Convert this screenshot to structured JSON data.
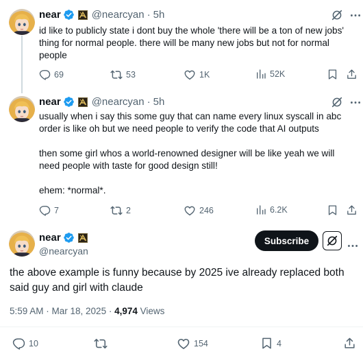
{
  "tweets": [
    {
      "name": "near",
      "handle": "@nearcyan",
      "separator": "·",
      "time": "5h",
      "text": "id like to publicly state i dont buy the whole 'there will be a ton of new jobs'\nthing for normal people. there will be many new jobs but not for normal\npeople",
      "replies": "69",
      "reposts": "53",
      "likes": "1K",
      "views": "52K"
    },
    {
      "name": "near",
      "handle": "@nearcyan",
      "separator": "·",
      "time": "5h",
      "text": "usually when i say this some guy that can name every linux syscall in abc\norder is like oh but we need people to verify the code that AI outputs\n\nthen some girl whos a world-renowned designer will be like yeah we will\nneed people with taste for good design still!\n\nehem: *normal*.",
      "replies": "7",
      "reposts": "2",
      "likes": "246",
      "views": "6.2K"
    }
  ],
  "main": {
    "name": "near",
    "handle": "@nearcyan",
    "subscribe_label": "Subscribe",
    "text": "the above example is funny because by 2025 ive already replaced both\nsaid guy and girl with claude",
    "timestamp": "5:59 AM · Mar 18, 2025 · ",
    "views_count": "4,974",
    "views_label": " Views",
    "replies": "10",
    "reposts": "",
    "likes": "154",
    "bookmarks": "4"
  },
  "colors": {
    "verified": "#1d9bf0",
    "text": "#0f1419",
    "muted": "#536471"
  },
  "icons": [
    "verified-badge-icon",
    "affiliate-badge-icon",
    "grok-icon",
    "more-icon",
    "reply-icon",
    "repost-icon",
    "like-icon",
    "views-icon",
    "bookmark-icon",
    "share-icon"
  ]
}
